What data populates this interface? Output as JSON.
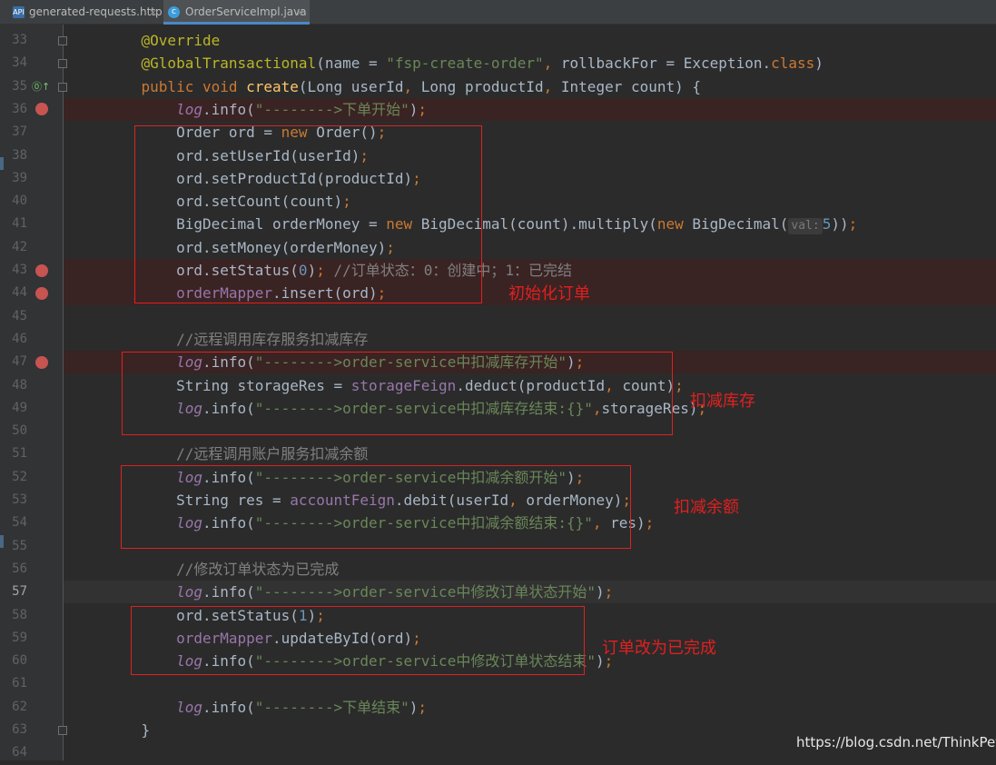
{
  "tabs": [
    {
      "label": "generated-requests.http",
      "close": "×",
      "icon": "api-icon"
    },
    {
      "label": "OrderServiceImpl.java",
      "close": "×",
      "icon": "class-icon",
      "active": true
    }
  ],
  "lines": [
    {
      "n": "33",
      "t": [
        [
          "    ",
          ""
        ],
        [
          "@Override",
          "ann"
        ]
      ]
    },
    {
      "n": "34",
      "t": [
        [
          "    ",
          ""
        ],
        [
          "@GlobalTransactional",
          "ann"
        ],
        [
          "(name = ",
          ""
        ],
        [
          "\"fsp-create-order\"",
          "str"
        ],
        [
          ", ",
          "kw"
        ],
        [
          "rollbackFor = Exception.",
          ""
        ],
        [
          "class",
          "kw"
        ],
        [
          ")",
          ""
        ]
      ]
    },
    {
      "n": "35",
      "impl": true,
      "t": [
        [
          "    ",
          ""
        ],
        [
          "public void ",
          "kw"
        ],
        [
          "create",
          "fn"
        ],
        [
          "(Long userId",
          ""
        ],
        [
          ", ",
          "kw"
        ],
        [
          "Long productId",
          ""
        ],
        [
          ", ",
          "kw"
        ],
        [
          "Integer count) {",
          ""
        ]
      ]
    },
    {
      "n": "36",
      "bp": true,
      "t": [
        [
          "        ",
          ""
        ],
        [
          "log",
          "fldi"
        ],
        [
          ".info(",
          ""
        ],
        [
          "\"-------->下单开始\"",
          "str"
        ],
        [
          ")",
          ""
        ],
        [
          ";",
          "kw"
        ]
      ]
    },
    {
      "n": "37",
      "t": [
        [
          "        ",
          ""
        ],
        [
          "Order ord = ",
          ""
        ],
        [
          "new ",
          "kw"
        ],
        [
          "Order()",
          ""
        ],
        [
          ";",
          "kw"
        ]
      ]
    },
    {
      "n": "38",
      "t": [
        [
          "        ",
          ""
        ],
        [
          "ord.setUserId(userId)",
          ""
        ],
        [
          ";",
          "kw"
        ]
      ]
    },
    {
      "n": "39",
      "t": [
        [
          "        ",
          ""
        ],
        [
          "ord.setProductId(productId)",
          ""
        ],
        [
          ";",
          "kw"
        ]
      ]
    },
    {
      "n": "40",
      "t": [
        [
          "        ",
          ""
        ],
        [
          "ord.setCount(count)",
          ""
        ],
        [
          ";",
          "kw"
        ]
      ]
    },
    {
      "n": "41",
      "t": [
        [
          "        ",
          ""
        ],
        [
          "BigDecimal orderMoney = ",
          ""
        ],
        [
          "new ",
          "kw"
        ],
        [
          "BigDecimal(count).multiply(",
          ""
        ],
        [
          "new ",
          "kw"
        ],
        [
          "BigDecimal(",
          ""
        ],
        [
          "val:",
          "hint"
        ],
        [
          "5",
          "num"
        ],
        [
          "))",
          ""
        ],
        [
          ";",
          "kw"
        ]
      ]
    },
    {
      "n": "42",
      "t": [
        [
          "        ",
          ""
        ],
        [
          "ord.setMoney(orderMoney)",
          ""
        ],
        [
          ";",
          "kw"
        ]
      ]
    },
    {
      "n": "43",
      "bp": true,
      "t": [
        [
          "        ",
          ""
        ],
        [
          "ord.setStatus(",
          ""
        ],
        [
          "0",
          "num"
        ],
        [
          ")",
          ""
        ],
        [
          "; ",
          "kw"
        ],
        [
          "//订单状态：0：创建中；1：已完结",
          "cmt"
        ]
      ]
    },
    {
      "n": "44",
      "bp": true,
      "t": [
        [
          "        ",
          ""
        ],
        [
          "orderMapper",
          "fld"
        ],
        [
          ".insert(ord)",
          ""
        ],
        [
          ";",
          "kw"
        ]
      ]
    },
    {
      "n": "45",
      "t": []
    },
    {
      "n": "46",
      "t": [
        [
          "        ",
          ""
        ],
        [
          "//远程调用库存服务扣减库存",
          "cmt"
        ]
      ]
    },
    {
      "n": "47",
      "bp": true,
      "t": [
        [
          "        ",
          ""
        ],
        [
          "log",
          "fldi"
        ],
        [
          ".info(",
          ""
        ],
        [
          "\"-------->order-service中扣减库存开始\"",
          "str"
        ],
        [
          ")",
          ""
        ],
        [
          ";",
          "kw"
        ]
      ]
    },
    {
      "n": "48",
      "t": [
        [
          "        ",
          ""
        ],
        [
          "String storageRes = ",
          ""
        ],
        [
          "storageFeign",
          "fld"
        ],
        [
          ".deduct(productId",
          ""
        ],
        [
          ", ",
          "kw"
        ],
        [
          "count)",
          ""
        ],
        [
          ";",
          "kw"
        ]
      ]
    },
    {
      "n": "49",
      "t": [
        [
          "        ",
          ""
        ],
        [
          "log",
          "fldi"
        ],
        [
          ".info(",
          ""
        ],
        [
          "\"-------->order-service中扣减库存结束:{}\"",
          "str"
        ],
        [
          ",",
          "kw"
        ],
        [
          "storageRes)",
          ""
        ],
        [
          ";",
          "kw"
        ]
      ]
    },
    {
      "n": "50",
      "t": []
    },
    {
      "n": "51",
      "t": [
        [
          "        ",
          ""
        ],
        [
          "//远程调用账户服务扣减余额",
          "cmt"
        ]
      ]
    },
    {
      "n": "52",
      "t": [
        [
          "        ",
          ""
        ],
        [
          "log",
          "fldi"
        ],
        [
          ".info(",
          ""
        ],
        [
          "\"-------->order-service中扣减余额开始\"",
          "str"
        ],
        [
          ")",
          ""
        ],
        [
          ";",
          "kw"
        ]
      ]
    },
    {
      "n": "53",
      "t": [
        [
          "        ",
          ""
        ],
        [
          "String res = ",
          ""
        ],
        [
          "accountFeign",
          "fld"
        ],
        [
          ".debit(userId",
          ""
        ],
        [
          ", ",
          "kw"
        ],
        [
          "orderMoney)",
          ""
        ],
        [
          ";",
          "kw"
        ]
      ]
    },
    {
      "n": "54",
      "t": [
        [
          "        ",
          ""
        ],
        [
          "log",
          "fldi"
        ],
        [
          ".info(",
          ""
        ],
        [
          "\"-------->order-service中扣减余额结束:{}\"",
          "str"
        ],
        [
          ", ",
          "kw"
        ],
        [
          "res)",
          ""
        ],
        [
          ";",
          "kw"
        ]
      ]
    },
    {
      "n": "55",
      "t": []
    },
    {
      "n": "56",
      "t": [
        [
          "        ",
          ""
        ],
        [
          "//修改订单状态为已完成",
          "cmt"
        ]
      ]
    },
    {
      "n": "57",
      "cur": true,
      "t": [
        [
          "        ",
          ""
        ],
        [
          "log",
          "fldi"
        ],
        [
          ".info(",
          ""
        ],
        [
          "\"-------->order-service中修改订单状态开始\"",
          "str"
        ],
        [
          ")",
          ""
        ],
        [
          ";",
          "kw"
        ]
      ]
    },
    {
      "n": "58",
      "t": [
        [
          "        ",
          ""
        ],
        [
          "ord.setStatus(",
          ""
        ],
        [
          "1",
          "num"
        ],
        [
          ")",
          ""
        ],
        [
          ";",
          "kw"
        ]
      ]
    },
    {
      "n": "59",
      "t": [
        [
          "        ",
          ""
        ],
        [
          "orderMapper",
          "fld"
        ],
        [
          ".updateById(ord)",
          ""
        ],
        [
          ";",
          "kw"
        ]
      ]
    },
    {
      "n": "60",
      "t": [
        [
          "        ",
          ""
        ],
        [
          "log",
          "fldi"
        ],
        [
          ".info(",
          ""
        ],
        [
          "\"-------->order-service中修改订单状态结束\"",
          "str"
        ],
        [
          ")",
          ""
        ],
        [
          ";",
          "kw"
        ]
      ]
    },
    {
      "n": "61",
      "t": []
    },
    {
      "n": "62",
      "t": [
        [
          "        ",
          ""
        ],
        [
          "log",
          "fldi"
        ],
        [
          ".info(",
          ""
        ],
        [
          "\"-------->下单结束\"",
          "str"
        ],
        [
          ")",
          ""
        ],
        [
          ";",
          "kw"
        ]
      ]
    },
    {
      "n": "63",
      "t": [
        [
          "    ",
          ""
        ],
        [
          "}",
          ""
        ]
      ]
    },
    {
      "n": "64",
      "t": []
    }
  ],
  "annotations": {
    "init_order": "初始化订单",
    "deduct_storage": "扣减库存",
    "deduct_balance": "扣减余额",
    "order_complete": "订单改为已完成"
  },
  "watermark": "https://blog.csdn.net/ThinkPet",
  "colors": {
    "keyword": "#cc7832",
    "string": "#6a8759",
    "annotation": "#bbb529",
    "comment": "#808080",
    "field": "#9876aa",
    "number": "#6897bb",
    "method": "#ffc66d",
    "highlight_box": "#e02020",
    "breakpoint": "#c75450"
  }
}
